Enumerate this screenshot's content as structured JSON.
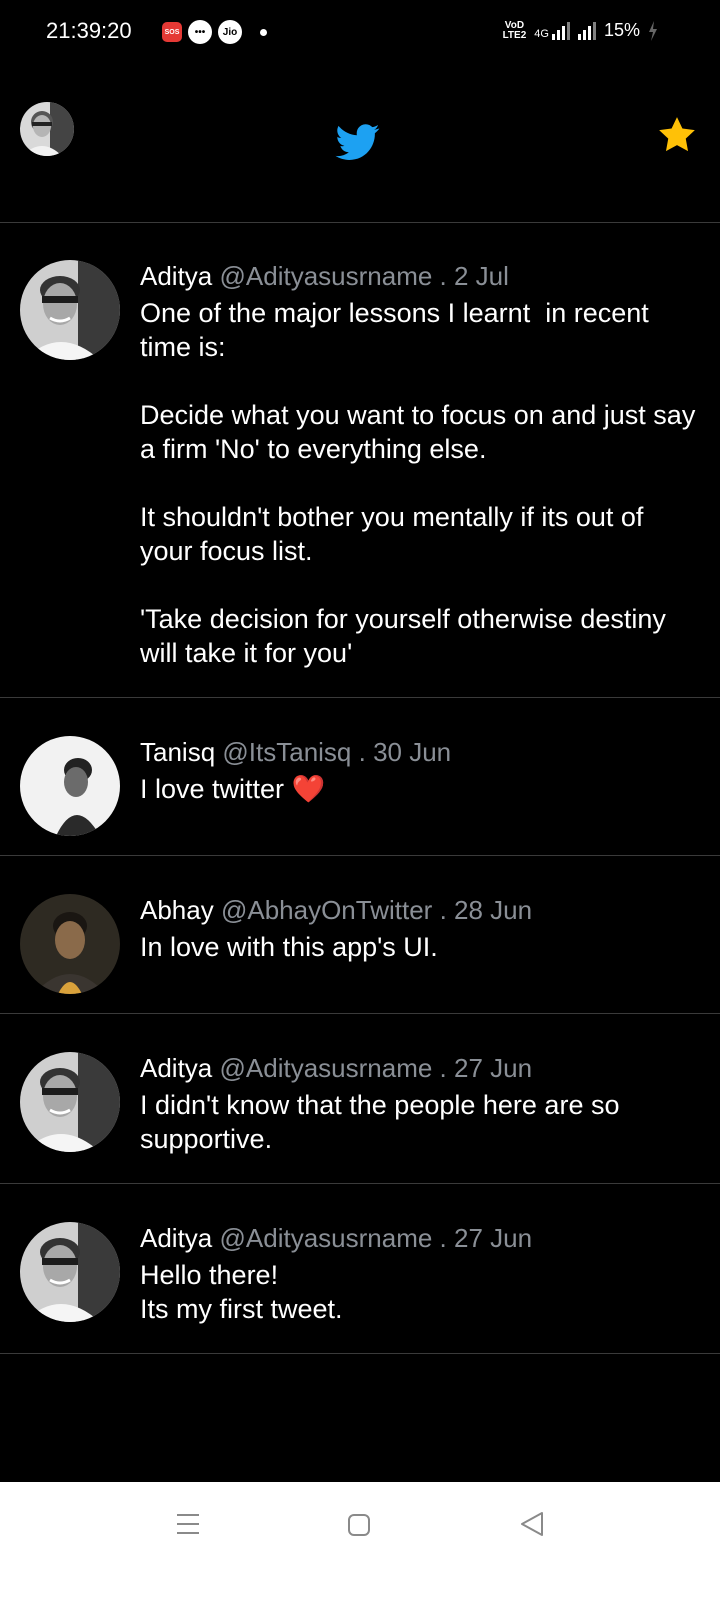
{
  "status_bar": {
    "time": "21:39:20",
    "sos_label": "SOS",
    "jio_label": "Jio",
    "network_type": "4G",
    "volte_line1": "VoD",
    "volte_line2": "LTE2",
    "battery": "15%"
  },
  "topbar": {
    "icons": [
      "profile-avatar",
      "twitter-bird-icon",
      "star-icon"
    ],
    "accent_color": "#1da1f2",
    "star_color": "#ffc107"
  },
  "tweets": [
    {
      "name": "Aditya",
      "handle": "@Adityasusrname",
      "date": ". 2 Jul",
      "text": "One of the major lessons I learnt  in recent time is:\n\nDecide what you want to focus on and just say a firm 'No' to everything else.\n\nIt shouldn't bother you mentally if its out of your focus list.\n\n'Take decision for yourself otherwise destiny will take it for you'"
    },
    {
      "name": "Tanisq",
      "handle": "@ItsTanisq",
      "date": ". 30 Jun",
      "text": "I love twitter ❤️"
    },
    {
      "name": "Abhay",
      "handle": "@AbhayOnTwitter",
      "date": ". 28 Jun",
      "text": "In love with this app's UI."
    },
    {
      "name": "Aditya",
      "handle": "@Adityasusrname",
      "date": ". 27 Jun",
      "text": "I didn't know that the people here are so supportive."
    },
    {
      "name": "Aditya",
      "handle": "@Adityasusrname",
      "date": ". 27 Jun",
      "text": "Hello there!\nIts my first tweet."
    }
  ]
}
